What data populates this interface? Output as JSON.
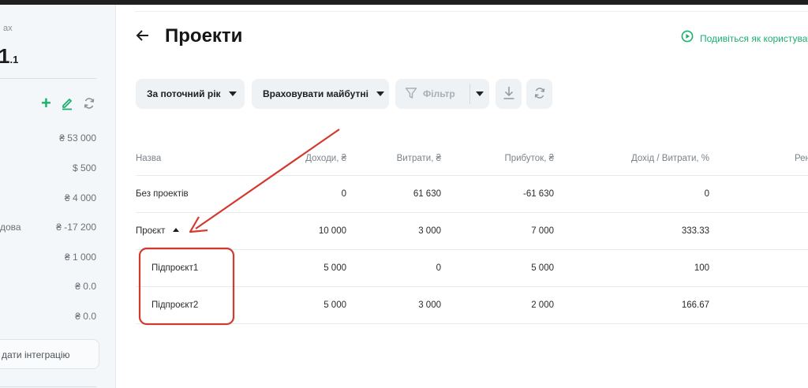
{
  "sidebar": {
    "top_label": "ах",
    "big_value": "1",
    "big_value_sub": ".1",
    "rows": [
      {
        "label": "",
        "value": "₴ 53 000"
      },
      {
        "label": "",
        "value": "$ 500"
      },
      {
        "label": "",
        "value": "₴ 4 000"
      },
      {
        "label": "дова",
        "value": "₴ -17 200"
      },
      {
        "label": "",
        "value": "₴ 1 000"
      },
      {
        "label": "",
        "value": "₴ 0.0"
      },
      {
        "label": "",
        "value": "₴ 0.0"
      }
    ],
    "integration_label": "дати інтеграцію"
  },
  "header": {
    "title": "Проекти",
    "view_as_label": "Подивіться як користувач"
  },
  "toolbar": {
    "period_label": "За поточний рік",
    "future_label": "Враховувати майбутні",
    "filter_placeholder": "Фільтр"
  },
  "table": {
    "columns": [
      "Назва",
      "Доходи, ₴",
      "Витрати, ₴",
      "Прибуток, ₴",
      "Дохід / Витрати, %",
      "Рен"
    ],
    "rows": [
      {
        "name": "Без проектів",
        "income": "0",
        "expenses": "61 630",
        "profit": "-61 630",
        "ratio": "0",
        "sub": false,
        "expandable": false
      },
      {
        "name": "Проєкт",
        "income": "10 000",
        "expenses": "3 000",
        "profit": "7 000",
        "ratio": "333.33",
        "sub": false,
        "expandable": true
      },
      {
        "name": "Підпроєкт1",
        "income": "5 000",
        "expenses": "0",
        "profit": "5 000",
        "ratio": "100",
        "sub": true,
        "expandable": false
      },
      {
        "name": "Підпроєкт2",
        "income": "5 000",
        "expenses": "3 000",
        "profit": "2 000",
        "ratio": "166.67",
        "sub": true,
        "expandable": false
      }
    ]
  },
  "colors": {
    "accent_green": "#19b06f",
    "annotation_red": "#d23a2f",
    "button_bg": "#eef2f5"
  },
  "icons": {
    "back": "arrow-left-icon",
    "view_as": "play-circle-icon",
    "add": "plus-icon",
    "edit": "pencil-icon",
    "sync": "refresh-icon",
    "filter": "funnel-icon",
    "download": "download-icon",
    "refresh": "refresh-icon"
  }
}
